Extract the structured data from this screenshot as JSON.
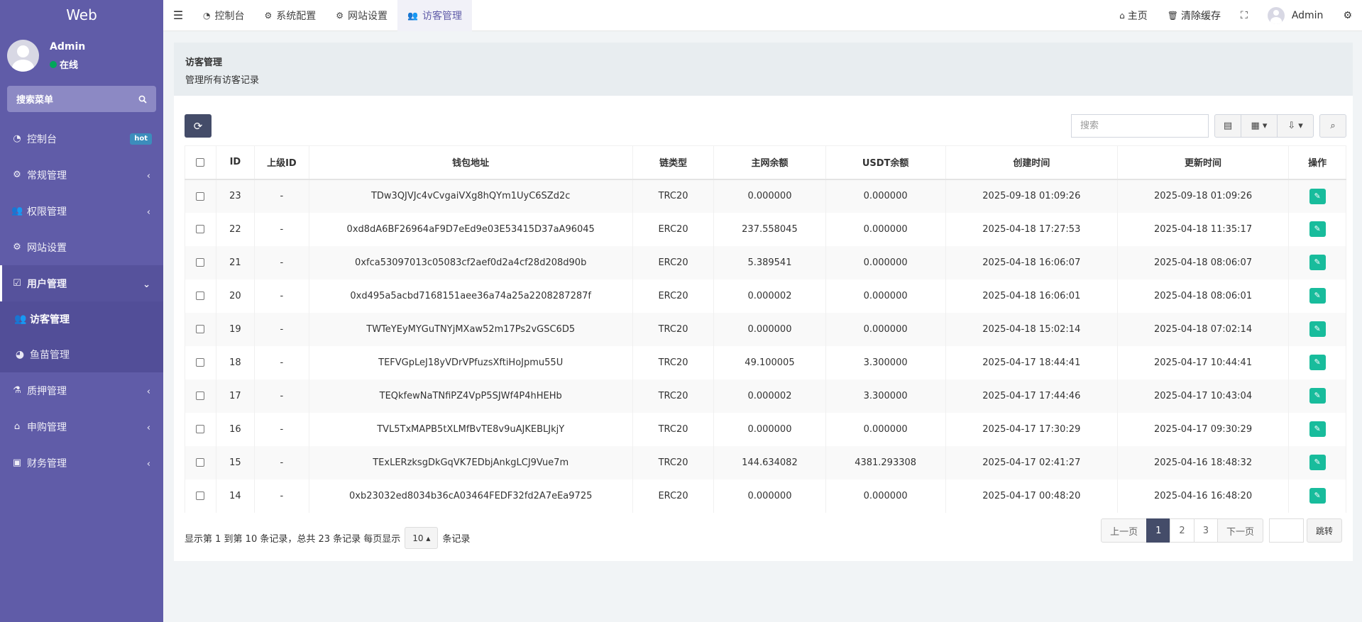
{
  "sidebar": {
    "logo": "Web",
    "user_name": "Admin",
    "user_status": "在线",
    "search_label": "搜索菜单",
    "menu": [
      {
        "label": "控制台",
        "badge": "hot"
      },
      {
        "label": "常规管理"
      },
      {
        "label": "权限管理"
      },
      {
        "label": "网站设置"
      },
      {
        "label": "用户管理"
      },
      {
        "label": "质押管理"
      },
      {
        "label": "申购管理"
      },
      {
        "label": "财务管理"
      }
    ],
    "submenu": [
      {
        "label": "访客管理"
      },
      {
        "label": "鱼苗管理"
      }
    ]
  },
  "navbar": {
    "tabs": [
      {
        "label": "控制台"
      },
      {
        "label": "系统配置"
      },
      {
        "label": "网站设置"
      },
      {
        "label": "访客管理"
      }
    ],
    "home": "主页",
    "clear_cache": "清除缓存",
    "admin": "Admin"
  },
  "page": {
    "title": "访客管理",
    "subtitle": "管理所有访客记录"
  },
  "toolbar": {
    "search_placeholder": "搜索"
  },
  "table": {
    "headers": [
      "ID",
      "上级ID",
      "钱包地址",
      "链类型",
      "主网余额",
      "USDT余额",
      "创建时间",
      "更新时间",
      "操作"
    ],
    "rows": [
      {
        "id": "23",
        "parent": "-",
        "wallet": "TDw3QJVJc4vCvgaiVXg8hQYm1UyC6SZd2c",
        "chain": "TRC20",
        "main_balance": "0.000000",
        "usdt": "0.000000",
        "created": "2025-09-18 01:09:26",
        "updated": "2025-09-18 01:09:26"
      },
      {
        "id": "22",
        "parent": "-",
        "wallet": "0xd8dA6BF26964aF9D7eEd9e03E53415D37aA96045",
        "chain": "ERC20",
        "main_balance": "237.558045",
        "usdt": "0.000000",
        "created": "2025-04-18 17:27:53",
        "updated": "2025-04-18 11:35:17"
      },
      {
        "id": "21",
        "parent": "-",
        "wallet": "0xfca53097013c05083cf2aef0d2a4cf28d208d90b",
        "chain": "ERC20",
        "main_balance": "5.389541",
        "usdt": "0.000000",
        "created": "2025-04-18 16:06:07",
        "updated": "2025-04-18 08:06:07"
      },
      {
        "id": "20",
        "parent": "-",
        "wallet": "0xd495a5acbd7168151aee36a74a25a2208287287f",
        "chain": "ERC20",
        "main_balance": "0.000002",
        "usdt": "0.000000",
        "created": "2025-04-18 16:06:01",
        "updated": "2025-04-18 08:06:01"
      },
      {
        "id": "19",
        "parent": "-",
        "wallet": "TWTeYEyMYGuTNYjMXaw52m17Ps2vGSC6D5",
        "chain": "TRC20",
        "main_balance": "0.000000",
        "usdt": "0.000000",
        "created": "2025-04-18 15:02:14",
        "updated": "2025-04-18 07:02:14"
      },
      {
        "id": "18",
        "parent": "-",
        "wallet": "TEFVGpLeJ18yVDrVPfuzsXftiHoJpmu55U",
        "chain": "TRC20",
        "main_balance": "49.100005",
        "usdt": "3.300000",
        "created": "2025-04-17 18:44:41",
        "updated": "2025-04-17 10:44:41"
      },
      {
        "id": "17",
        "parent": "-",
        "wallet": "TEQkfewNaTNfiPZ4VpP5SJWf4P4hHEHb",
        "chain": "TRC20",
        "main_balance": "0.000002",
        "usdt": "3.300000",
        "created": "2025-04-17 17:44:46",
        "updated": "2025-04-17 10:43:04"
      },
      {
        "id": "16",
        "parent": "-",
        "wallet": "TVL5TxMAPB5tXLMfBvTE8v9uAJKEBLJkjY",
        "chain": "TRC20",
        "main_balance": "0.000000",
        "usdt": "0.000000",
        "created": "2025-04-17 17:30:29",
        "updated": "2025-04-17 09:30:29"
      },
      {
        "id": "15",
        "parent": "-",
        "wallet": "TExLERzksgDkGqVK7EDbjAnkgLCJ9Vue7m",
        "chain": "TRC20",
        "main_balance": "144.634082",
        "usdt": "4381.293308",
        "created": "2025-04-17 02:41:27",
        "updated": "2025-04-16 18:48:32"
      },
      {
        "id": "14",
        "parent": "-",
        "wallet": "0xb23032ed8034b36cA03464FEDF32fd2A7eEa9725",
        "chain": "ERC20",
        "main_balance": "0.000000",
        "usdt": "0.000000",
        "created": "2025-04-17 00:48:20",
        "updated": "2025-04-16 16:48:20"
      }
    ]
  },
  "pagination": {
    "summary": "显示第 1 到第 10 条记录，总共 23 条记录 每页显示",
    "per_page": "10",
    "per_page_suffix": "条记录",
    "prev": "上一页",
    "pages": [
      "1",
      "2",
      "3"
    ],
    "current_page": "1",
    "next": "下一页",
    "jump": "跳转"
  },
  "colors": {
    "sidebar_bg": "#605ca8",
    "accent": "#444c69",
    "chain_text": "#18bc9c",
    "edit_button": "#18bc9c",
    "online_dot": "#00a65a"
  }
}
